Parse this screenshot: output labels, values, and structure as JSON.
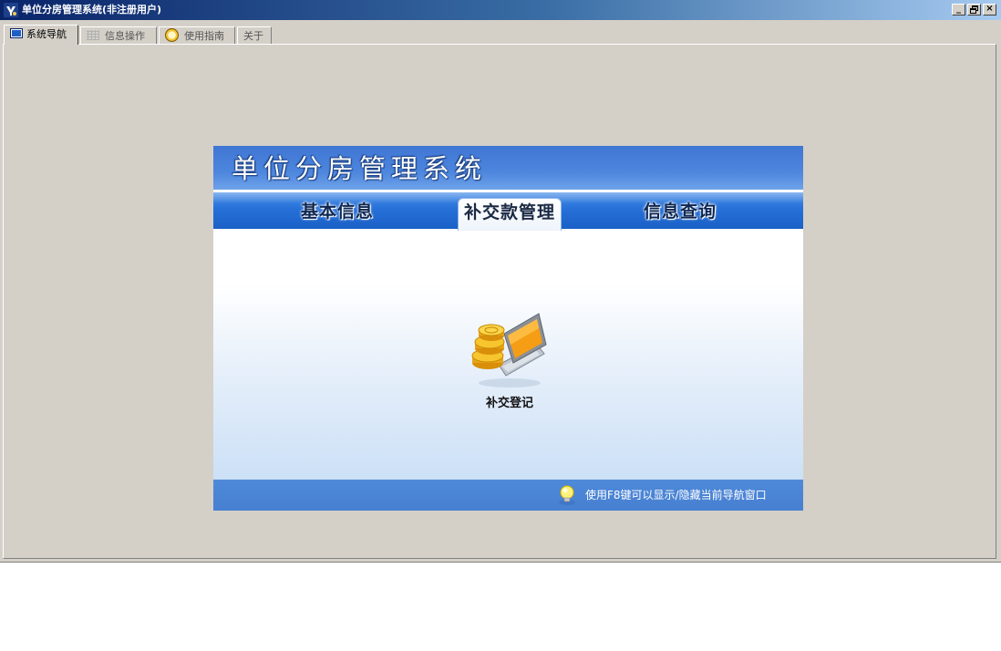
{
  "window": {
    "title": "单位分房管理系统(非注册用户)",
    "buttons": {
      "minimize": "_",
      "restore": "🗗",
      "close": "×"
    }
  },
  "tabs": [
    {
      "label": "系统导航",
      "icon": "monitor-icon",
      "active": true
    },
    {
      "label": "信息操作",
      "icon": "grid-icon",
      "active": false
    },
    {
      "label": "使用指南",
      "icon": "help-icon",
      "active": false
    },
    {
      "label": "关于",
      "icon": "",
      "active": false
    }
  ],
  "nav": {
    "title": "单位分房管理系统",
    "tabs": [
      {
        "label": "基本信息",
        "active": false
      },
      {
        "label": "补交款管理",
        "active": true
      },
      {
        "label": "信息查询",
        "active": false
      }
    ],
    "features": [
      {
        "label": "补交登记",
        "icon": "coins-laptop-icon"
      }
    ],
    "footer": {
      "tip": "使用F8键可以显示/隐藏当前导航窗口",
      "icon": "lightbulb-icon"
    }
  },
  "colors": {
    "titlebar_start": "#0a246a",
    "titlebar_end": "#a6caf0",
    "window_bg": "#d4d0c8",
    "nav_header": "#4d86dd",
    "nav_tabbar": "#2670d8",
    "nav_footer": "#4e8ad9"
  }
}
